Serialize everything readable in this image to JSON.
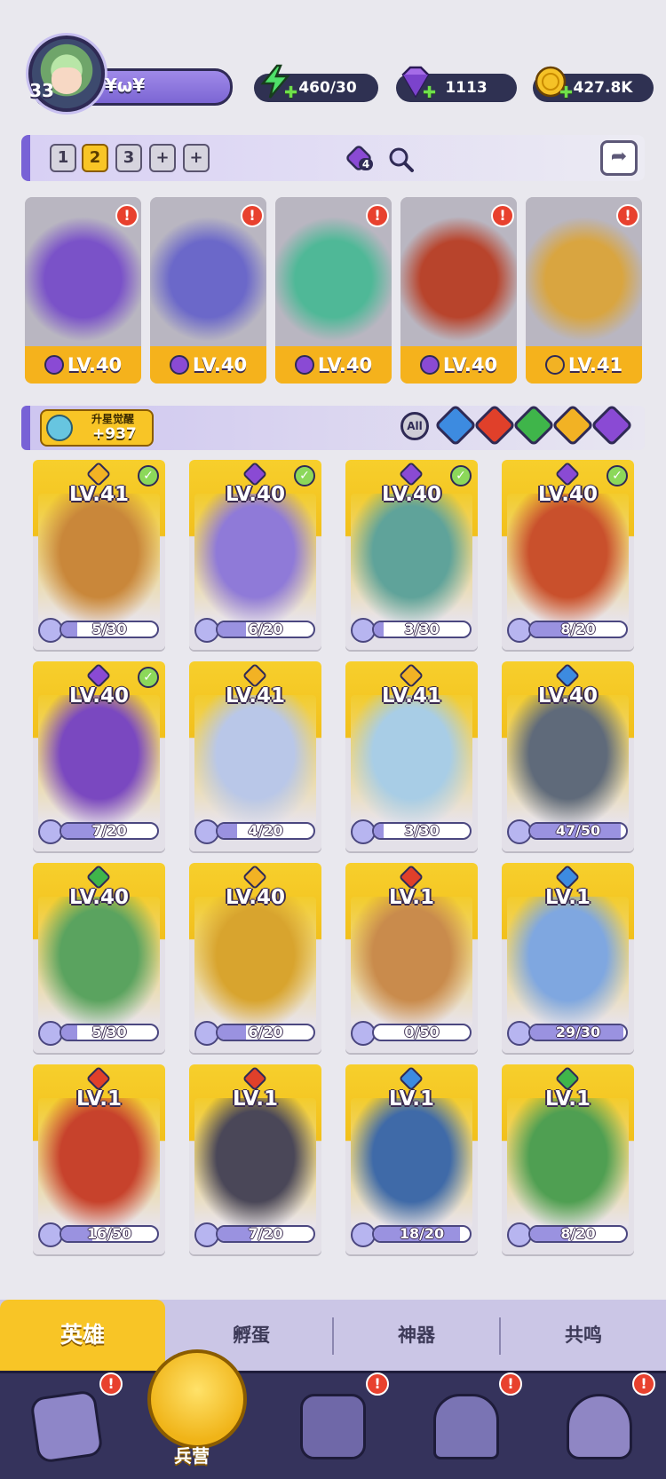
{
  "player": {
    "level": "33",
    "name": "¥ω¥"
  },
  "resources": {
    "energy": "460/30",
    "gems": "1113",
    "gold": "427.8K"
  },
  "team_bar": {
    "slots": [
      "1",
      "2",
      "3",
      "+",
      "+"
    ],
    "active_slot": "2",
    "buff_count": "4"
  },
  "lineup": [
    {
      "level": "LV.40",
      "element": "dark",
      "alert": "!",
      "color": "#7a52c8"
    },
    {
      "level": "LV.40",
      "element": "dark",
      "alert": "!",
      "color": "#6b68c9"
    },
    {
      "level": "LV.40",
      "element": "dark",
      "alert": "!",
      "color": "#4fb897"
    },
    {
      "level": "LV.40",
      "element": "dark",
      "alert": "!",
      "color": "#b8442c"
    },
    {
      "level": "LV.41",
      "element": "light",
      "alert": "!",
      "color": "#d9a540"
    }
  ],
  "filter_bar": {
    "star_awaken_title": "升星觉醒",
    "star_awaken_value": "+937",
    "all_label": "All",
    "elements": [
      {
        "name": "water",
        "color": "#3d8be0"
      },
      {
        "name": "fire",
        "color": "#e0402a"
      },
      {
        "name": "wind",
        "color": "#3fb54a"
      },
      {
        "name": "light",
        "color": "#f2b224"
      },
      {
        "name": "dark",
        "color": "#8a4ad4"
      }
    ]
  },
  "heroes": [
    {
      "level": "LV.41",
      "element_color": "#f2b224",
      "checked": true,
      "shards": "5/30",
      "progress": 0.17,
      "art": "#c9873a"
    },
    {
      "level": "LV.40",
      "element_color": "#8a4ad4",
      "checked": true,
      "shards": "6/20",
      "progress": 0.3,
      "art": "#8f7ad8"
    },
    {
      "level": "LV.40",
      "element_color": "#8a4ad4",
      "checked": true,
      "shards": "3/30",
      "progress": 0.1,
      "art": "#5fa39a"
    },
    {
      "level": "LV.40",
      "element_color": "#8a4ad4",
      "checked": true,
      "shards": "8/20",
      "progress": 0.4,
      "art": "#c9502c"
    },
    {
      "level": "LV.40",
      "element_color": "#8a4ad4",
      "checked": true,
      "shards": "7/20",
      "progress": 0.35,
      "art": "#7a48c0"
    },
    {
      "level": "LV.41",
      "element_color": "#f2b224",
      "checked": false,
      "shards": "4/20",
      "progress": 0.2,
      "art": "#b9c7e8"
    },
    {
      "level": "LV.41",
      "element_color": "#f2b224",
      "checked": false,
      "shards": "3/30",
      "progress": 0.1,
      "art": "#a8cde6"
    },
    {
      "level": "LV.40",
      "element_color": "#3d8be0",
      "checked": false,
      "shards": "47/50",
      "progress": 0.94,
      "art": "#5f6a7a"
    },
    {
      "level": "LV.40",
      "element_color": "#3fb54a",
      "checked": false,
      "shards": "5/30",
      "progress": 0.17,
      "art": "#5aa35f"
    },
    {
      "level": "LV.40",
      "element_color": "#f2b224",
      "checked": false,
      "shards": "6/20",
      "progress": 0.3,
      "art": "#d8a42e"
    },
    {
      "level": "LV.1",
      "element_color": "#e0402a",
      "checked": false,
      "shards": "0/50",
      "progress": 0.0,
      "art": "#c98b4c"
    },
    {
      "level": "LV.1",
      "element_color": "#3d8be0",
      "checked": false,
      "shards": "29/30",
      "progress": 0.97,
      "art": "#7fa7e0"
    },
    {
      "level": "LV.1",
      "element_color": "#e0402a",
      "checked": false,
      "shards": "16/50",
      "progress": 0.32,
      "art": "#c7422c"
    },
    {
      "level": "LV.1",
      "element_color": "#e0402a",
      "checked": false,
      "shards": "7/20",
      "progress": 0.35,
      "art": "#4a4758"
    },
    {
      "level": "LV.1",
      "element_color": "#3d8be0",
      "checked": false,
      "shards": "18/20",
      "progress": 0.9,
      "art": "#3f6aa8"
    },
    {
      "level": "LV.1",
      "element_color": "#3fb54a",
      "checked": false,
      "shards": "8/20",
      "progress": 0.4,
      "art": "#4f9f52"
    }
  ],
  "sub_tabs": [
    "英雄",
    "孵蛋",
    "神器",
    "共鸣"
  ],
  "sub_tab_active": "英雄",
  "nav": {
    "items": [
      {
        "name": "cards",
        "alert": "!"
      },
      {
        "name": "barracks",
        "label": "兵营"
      },
      {
        "name": "map",
        "alert": "!"
      },
      {
        "name": "shrine",
        "alert": "!"
      },
      {
        "name": "mushroom",
        "alert": "!"
      }
    ]
  }
}
